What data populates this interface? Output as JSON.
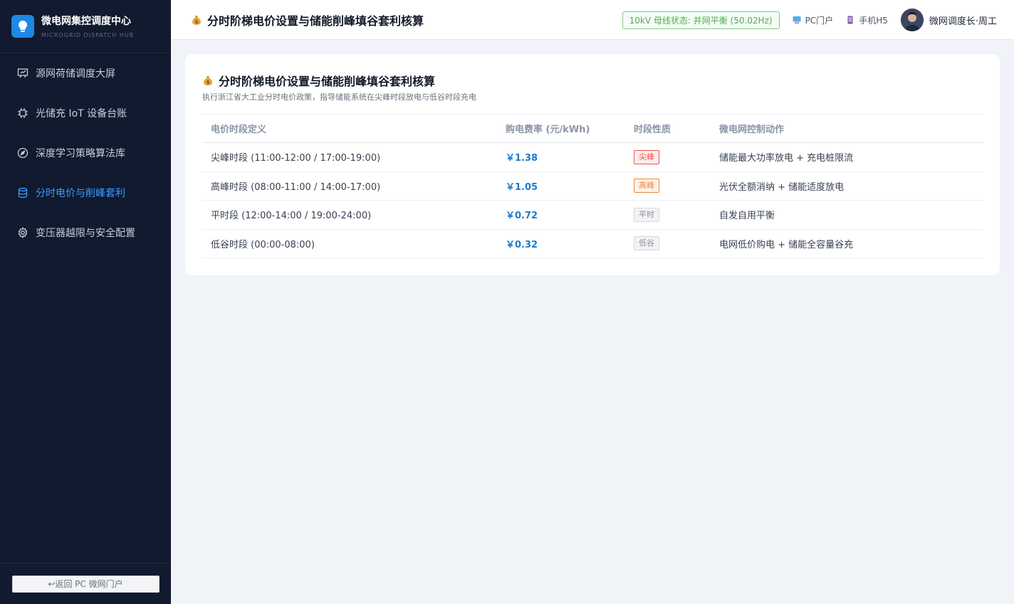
{
  "brand": {
    "title": "微电网集控调度中心",
    "subtitle": "MICROGRID DISPATCH HUB",
    "logo_icon": "lightbulb-icon"
  },
  "sidebar": {
    "items": [
      {
        "label": "源网荷储调度大屏",
        "icon": "presentation-board-icon",
        "active": false
      },
      {
        "label": "光储充 IoT 设备台账",
        "icon": "chip-icon",
        "active": false
      },
      {
        "label": "深度学习策略算法库",
        "icon": "compass-icon",
        "active": false
      },
      {
        "label": "分时电价与削峰套利",
        "icon": "database-icon",
        "active": true
      },
      {
        "label": "变压器越限与安全配置",
        "icon": "gear-icon",
        "active": false
      }
    ],
    "back_button": "↩返回 PC 微网门户"
  },
  "header": {
    "title": "分时阶梯电价设置与储能削峰填谷套利核算",
    "title_icon": "money-bag-icon",
    "bus_status": "10kV 母线状态: 并网平衡 (50.02Hz)",
    "pc_portal": "PC门户",
    "mobile_h5": "手机H5",
    "user_name": "微网调度长·周工"
  },
  "card": {
    "title": "分时阶梯电价设置与储能削峰填谷套利核算",
    "title_icon": "money-bag-icon",
    "description": "执行浙江省大工业分时电价政策，指导储能系统在尖峰时段放电与低谷时段充电",
    "columns": [
      "电价时段定义",
      "购电费率 (元/kWh)",
      "时段性质",
      "微电网控制动作"
    ],
    "rows": [
      {
        "period": "尖峰时段 (11:00-12:00 / 17:00-19:00)",
        "price": "￥1.38",
        "tag": "尖峰",
        "tag_color": "#ef5350",
        "tag_bg": "#fdecec",
        "action": "储能最大功率放电 + 充电桩限流"
      },
      {
        "period": "高峰时段 (08:00-11:00 / 14:00-17:00)",
        "price": "￥1.05",
        "tag": "高峰",
        "tag_color": "#f0883e",
        "tag_bg": "#fdf1e6",
        "action": "光伏全额消纳 + 储能适度放电"
      },
      {
        "period": "平时段 (12:00-14:00 / 19:00-24:00)",
        "price": "￥0.72",
        "tag": "平时",
        "tag_color": "#8b8f97",
        "tag_bg": "#f2f3f5",
        "action": "自发自用平衡"
      },
      {
        "period": "低谷时段 (00:00-08:00)",
        "price": "￥0.32",
        "tag": "低谷",
        "tag_color": "#8b8f97",
        "tag_bg": "#f2f3f5",
        "action": "电网低价购电 + 储能全容量谷充"
      }
    ]
  }
}
